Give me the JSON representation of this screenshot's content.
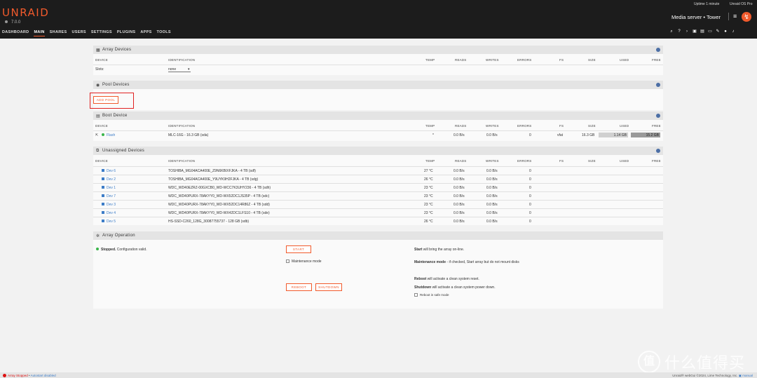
{
  "header": {
    "logo": "UNRAID",
    "version": "7.0.0",
    "nav": [
      "DASHBOARD",
      "MAIN",
      "SHARES",
      "USERS",
      "SETTINGS",
      "PLUGINS",
      "APPS",
      "TOOLS"
    ],
    "uptime": "Uptime 1 minute",
    "os": "Unraid OS Pro",
    "server": "Media server • Tower",
    "tool_icons": [
      "search-icon",
      "help-icon",
      "terminal-icon",
      "copy-icon",
      "log-icon",
      "monitor-icon",
      "feedback-icon",
      "info-icon",
      "bell-icon"
    ]
  },
  "array": {
    "title": "Array Devices",
    "columns": [
      "DEVICE",
      "IDENTIFICATION",
      "TEMP",
      "READS",
      "WRITES",
      "ERRORS",
      "FS",
      "SIZE",
      "USED",
      "FREE"
    ],
    "slots_label": "Slots:",
    "slots_value": "none"
  },
  "pool": {
    "title": "Pool Devices",
    "add_button": "ADD POOL"
  },
  "boot": {
    "title": "Boot Device",
    "columns": [
      "DEVICE",
      "IDENTIFICATION",
      "TEMP",
      "READS",
      "WRITES",
      "ERRORS",
      "FS",
      "SIZE",
      "USED",
      "FREE"
    ],
    "row": {
      "device": "Flash",
      "id": "MLC-16G - 16.3 GB (sda)",
      "temp": "*",
      "reads": "0.0 B/s",
      "writes": "0.0 B/s",
      "errors": "0",
      "fs": "vfat",
      "size": "16.3 GB",
      "used": "1.14 GB",
      "free": "15.2 GB"
    }
  },
  "unassigned": {
    "title": "Unassigned Devices",
    "columns": [
      "DEVICE",
      "IDENTIFICATION",
      "TEMP",
      "READS",
      "WRITES",
      "ERRORS",
      "FS",
      "SIZE",
      "USED",
      "FREE"
    ],
    "rows": [
      {
        "device": "Dev 6",
        "id": "TOSHIBA_MG04ACA400E_Z9N6KBIXFJKA - 4 TB (sdf)",
        "temp": "27 °C",
        "reads": "0.0 B/s",
        "writes": "0.0 B/s",
        "errors": "0"
      },
      {
        "device": "Dev 2",
        "id": "TOSHIBA_MG04ACA400E_Y9UYK9H2FJKA - 4 TB (sdg)",
        "temp": "26 °C",
        "reads": "0.0 B/s",
        "writes": "0.0 B/s",
        "errors": "0"
      },
      {
        "device": "Dev 1",
        "id": "WDC_WD40EZRZ-00GXCB0_WD-WCC7K3UHY236 - 4 TB (sdh)",
        "temp": "23 °C",
        "reads": "0.0 B/s",
        "writes": "0.0 B/s",
        "errors": "0"
      },
      {
        "device": "Dev 7",
        "id": "WDC_WD40PURX-78AKYY0_WD-WX52DC1JS35P - 4 TB (sdc)",
        "temp": "23 °C",
        "reads": "0.0 B/s",
        "writes": "0.0 B/s",
        "errors": "0"
      },
      {
        "device": "Dev 3",
        "id": "WDC_WD40PURX-78AKYY0_WD-WX52DC14R86Z - 4 TB (sdd)",
        "temp": "23 °C",
        "reads": "0.0 B/s",
        "writes": "0.0 B/s",
        "errors": "0"
      },
      {
        "device": "Dev 4",
        "id": "WDC_WD40PURX-78AKYY0_WD-WX42DC1LFS10 - 4 TB (sde)",
        "temp": "23 °C",
        "reads": "0.0 B/s",
        "writes": "0.0 B/s",
        "errors": "0"
      },
      {
        "device": "Dev 5",
        "id": "HS-SSD-C260_128G_30087755737 - 128 GB (sdb)",
        "temp": "26 °C",
        "reads": "0.0 B/s",
        "writes": "0.0 B/s",
        "errors": "0"
      }
    ]
  },
  "operation": {
    "title": "Array Operation",
    "status_bold": "Stopped.",
    "status_rest": "Configuration valid.",
    "start_button": "START",
    "start_desc_bold": "Start",
    "start_desc": "will bring the array on-line.",
    "maint_label": "Maintenance mode",
    "maint_desc_bold": "Maintenance mode",
    "maint_desc": "- if checked, Start array but do not mount disks",
    "reboot_button": "REBOOT",
    "shutdown_button": "SHUTDOWN",
    "reboot_desc_bold": "Reboot",
    "reboot_desc": "will activate a clean system reset.",
    "shutdown_desc_bold": "Shutdown",
    "shutdown_desc": "will activate a clean system power down.",
    "safe_label": "Reboot in safe mode"
  },
  "footer": {
    "array_status": "Array Stopped",
    "sep": "•",
    "autostart": "Autostart disabled",
    "copyright": "Unraid® webGui ©2024, Lime Technology, Inc.",
    "manual": "manual"
  },
  "watermark": {
    "circle": "值",
    "text": "什么值得买"
  },
  "colors": {
    "accent": "#f15a2c",
    "link": "#3d7dc8",
    "ok": "#3ab54a"
  }
}
